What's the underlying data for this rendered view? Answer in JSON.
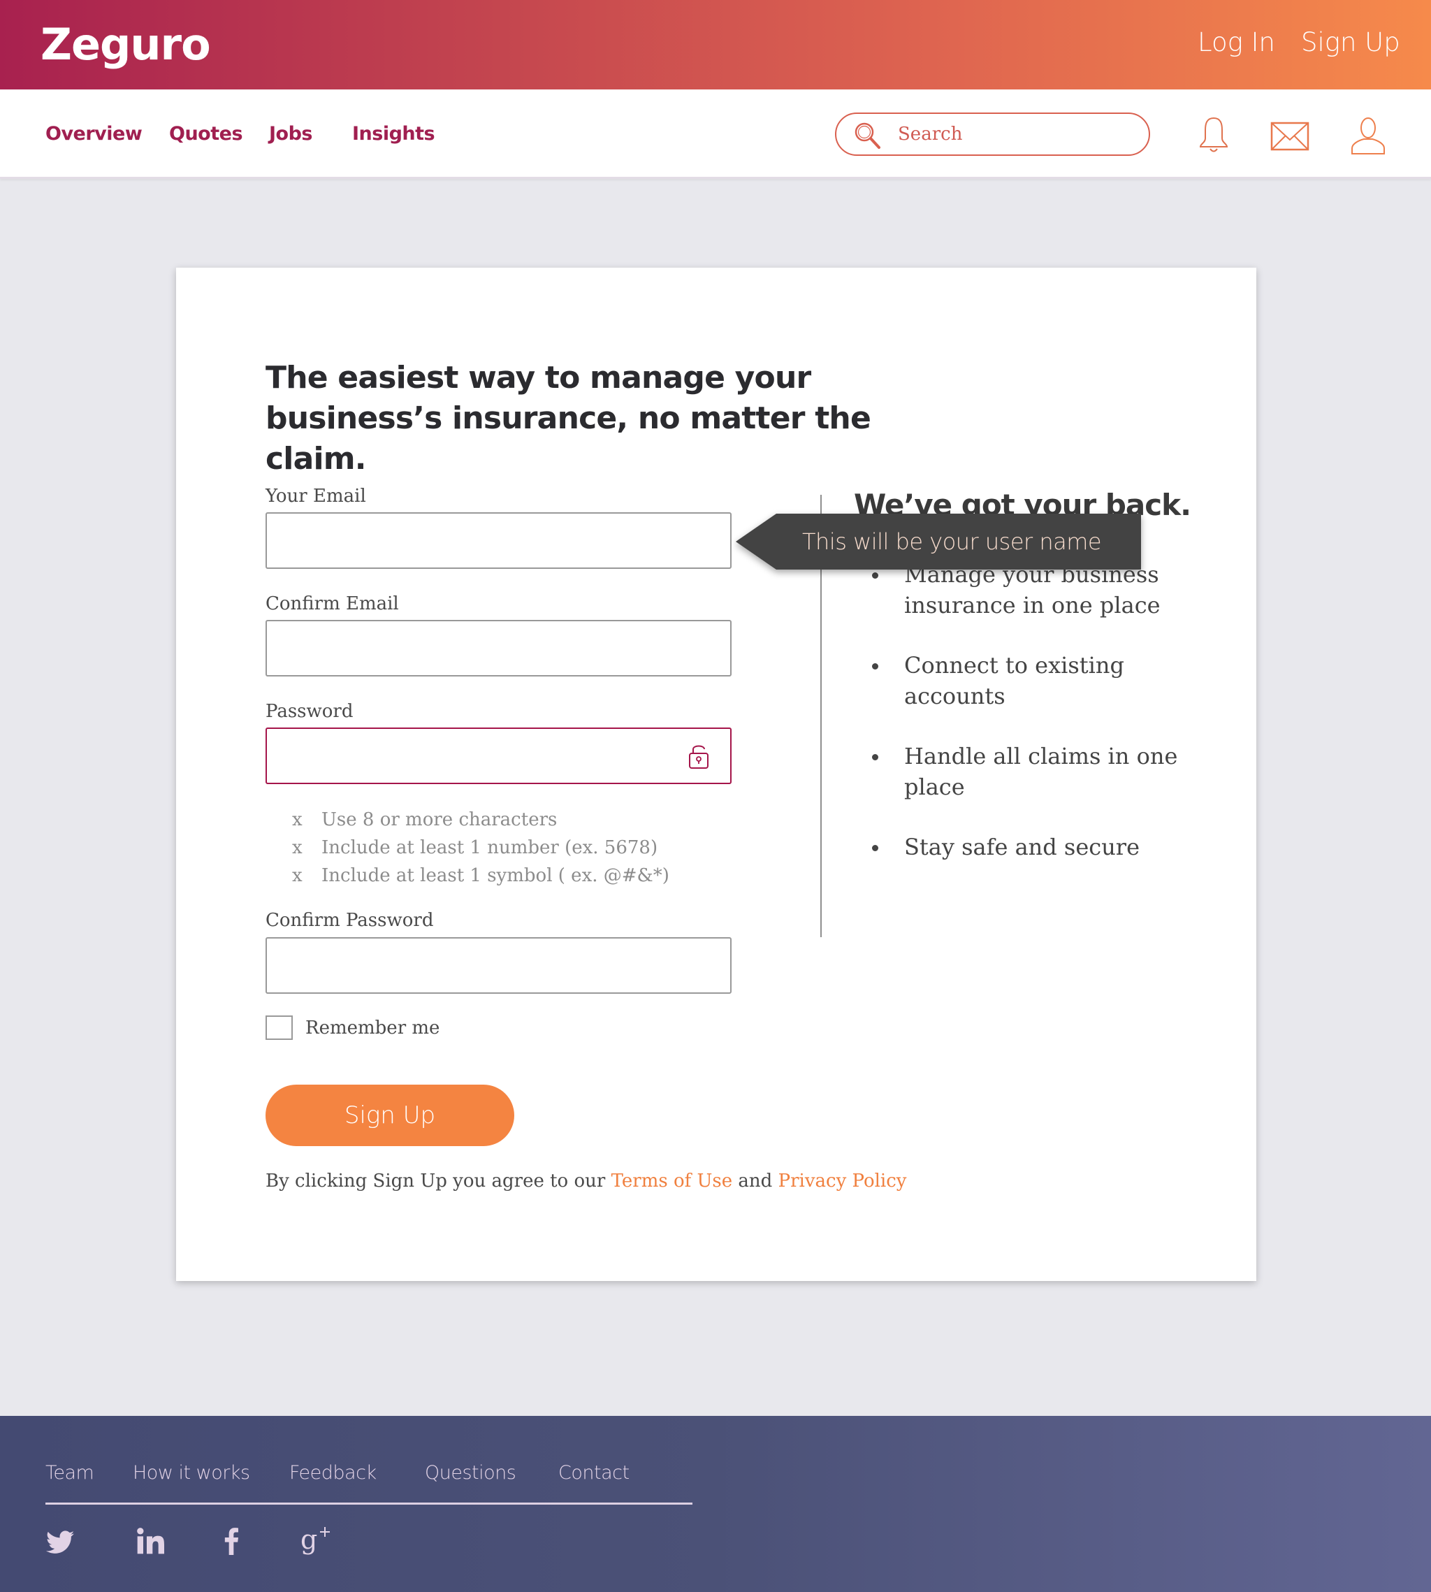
{
  "header": {
    "logo": "Zeguro",
    "login_label": "Log In",
    "signup_label": "Sign Up"
  },
  "nav": {
    "items": [
      {
        "label": "Overview"
      },
      {
        "label": "Quotes"
      },
      {
        "label": "Jobs"
      },
      {
        "label": "Insights"
      }
    ],
    "search": {
      "placeholder": "Search",
      "value": "",
      "icon": "search-icon"
    },
    "icons": [
      "bell-icon",
      "mail-icon",
      "user-icon"
    ]
  },
  "form": {
    "headline": "The easiest way to manage your business’s insurance, no matter the claim.",
    "email": {
      "label": "Your Email",
      "value": ""
    },
    "confirm_email": {
      "label": "Confirm Email",
      "value": ""
    },
    "password": {
      "label": "Password",
      "value": "",
      "icon": "unlock-icon"
    },
    "password_requirements": [
      {
        "marker": "x",
        "text": "Use 8 or more characters"
      },
      {
        "marker": "x",
        "text": "Include at least 1 number (ex. 5678)"
      },
      {
        "marker": "x",
        "text": "Include at least 1 symbol ( ex. @#&*)"
      }
    ],
    "confirm_password": {
      "label": "Confirm Password",
      "value": ""
    },
    "remember_me": {
      "label": "Remember me",
      "checked": false
    },
    "submit_label": "Sign Up",
    "terms": {
      "prefix": "By clicking Sign Up you agree to our ",
      "terms_link": "Terms of Use",
      "middle": " and ",
      "privacy_link": "Privacy Policy"
    }
  },
  "tooltip": {
    "text": "This will be your user name"
  },
  "side": {
    "title": "We’ve got your back.",
    "benefits": [
      "Manage your business insurance in one place",
      "Connect to existing accounts",
      "Handle all claims in one place",
      "Stay safe and secure"
    ]
  },
  "footer": {
    "links": [
      {
        "label": "Team"
      },
      {
        "label": "How it works"
      },
      {
        "label": "Feedback"
      },
      {
        "label": "Questions"
      },
      {
        "label": "Contact"
      }
    ],
    "social": [
      "twitter-icon",
      "linkedin-icon",
      "facebook-icon",
      "google-plus-icon"
    ]
  },
  "colors": {
    "brand_primary": "#a5154a",
    "brand_accent": "#f48441",
    "header_gradient_start": "#a8214f",
    "header_gradient_end": "#f68a4b",
    "footer_bg": "#4b5177",
    "page_bg": "#e8e8ed",
    "tooltip_bg": "#434343"
  }
}
